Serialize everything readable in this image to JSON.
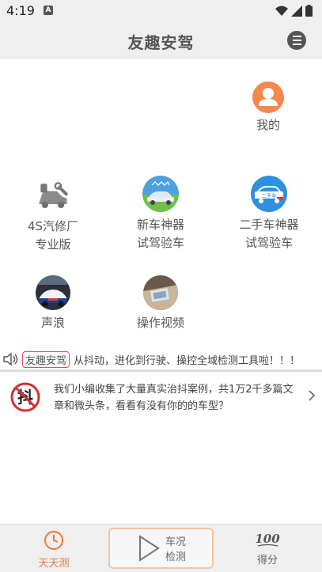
{
  "status_bar": {
    "time": "4:19",
    "notif_letter": "A"
  },
  "header": {
    "title": "友趣安驾"
  },
  "tiles": {
    "mine": {
      "label": "我的"
    },
    "repair": {
      "line1": "4S汽修厂",
      "line2": "专业版"
    },
    "new_car": {
      "line1": "新车神器",
      "line2": "试驾验车"
    },
    "used_car": {
      "line1": "二手车神器",
      "line2": "试驾验车",
      "icon_text": "二手车"
    },
    "sound": {
      "label": "声浪"
    },
    "video": {
      "label": "操作视频"
    }
  },
  "ticker": {
    "badge": "友趣安驾",
    "text": "从抖动，进化到行驶、操控全域检测工具啦！！！"
  },
  "news": {
    "icon_char": "抖",
    "text": "我们小编收集了大量真实治抖案例，共1万2千多篇文章和微头条，看看有没有你的的车型？"
  },
  "bottom_nav": {
    "daily": {
      "label": "天天测"
    },
    "check": {
      "line1": "车况",
      "line2": "检测"
    },
    "score": {
      "label": "得分",
      "icon_text": "100"
    }
  },
  "colors": {
    "accent": "#f0782d",
    "avatar": "#f5884a",
    "badge_border": "#d9534f",
    "forbid_red": "#d32f2f"
  }
}
